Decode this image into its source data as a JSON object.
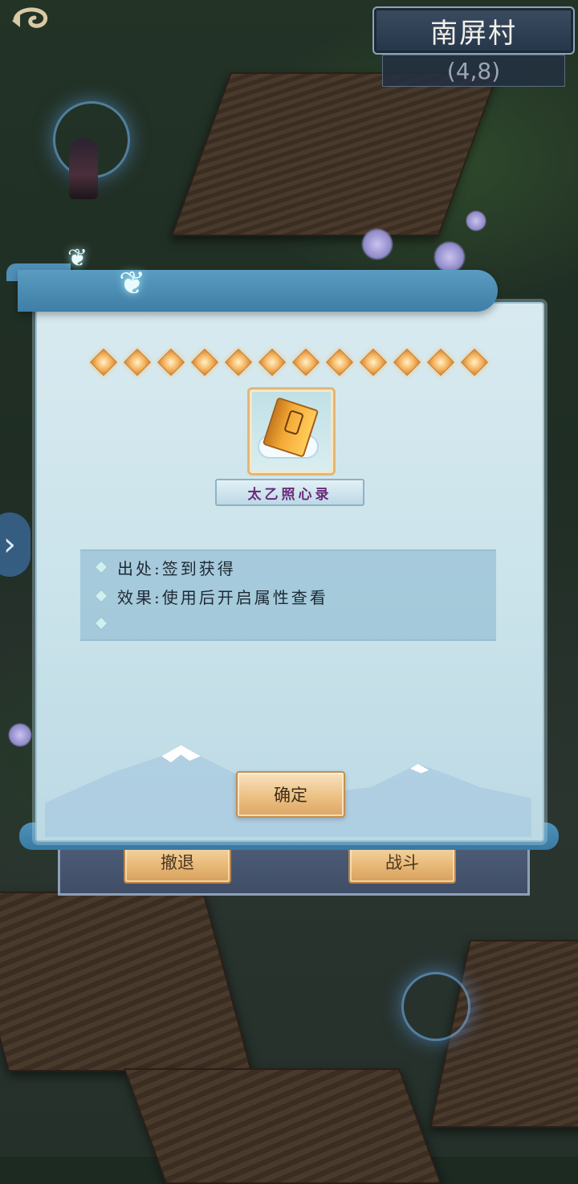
{
  "hud": {
    "back_icon": "swirl-back-icon",
    "location_name": "南屏村",
    "coordinates": "(4,8)",
    "side_arrow": "›"
  },
  "battle_panel": {
    "retreat_label": "撤退",
    "fight_label": "战斗"
  },
  "dialog": {
    "star_count": 12,
    "item_icon": "book-on-cloud-icon",
    "item_name": "太乙照心录",
    "info": [
      {
        "label": "出处:签到获得"
      },
      {
        "label": "效果:使用后开启属性查看"
      },
      {
        "label": ""
      }
    ],
    "confirm_label": "确定"
  },
  "colors": {
    "dialog_bg": "#c9e2ea",
    "scroll_blue": "#3f7ea6",
    "gold_button": "#e9bb7a",
    "item_name_text": "#6a2a7a",
    "star_gold": "#f4b25e"
  }
}
